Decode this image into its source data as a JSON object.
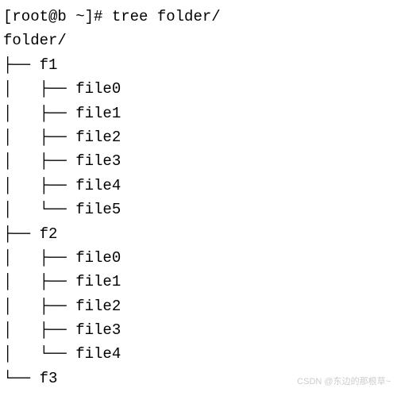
{
  "prompt": {
    "prefix": "[root@b ~]# ",
    "command": "tree folder/"
  },
  "root": "folder/",
  "tree": [
    {
      "prefix": "├── ",
      "indent": "",
      "name": "f1"
    },
    {
      "prefix": "├── ",
      "indent": "│   ",
      "name": "file0"
    },
    {
      "prefix": "├── ",
      "indent": "│   ",
      "name": "file1"
    },
    {
      "prefix": "├── ",
      "indent": "│   ",
      "name": "file2"
    },
    {
      "prefix": "├── ",
      "indent": "│   ",
      "name": "file3"
    },
    {
      "prefix": "├── ",
      "indent": "│   ",
      "name": "file4"
    },
    {
      "prefix": "└── ",
      "indent": "│   ",
      "name": "file5"
    },
    {
      "prefix": "├── ",
      "indent": "",
      "name": "f2"
    },
    {
      "prefix": "├── ",
      "indent": "│   ",
      "name": "file0"
    },
    {
      "prefix": "├── ",
      "indent": "│   ",
      "name": "file1"
    },
    {
      "prefix": "├── ",
      "indent": "│   ",
      "name": "file2"
    },
    {
      "prefix": "├── ",
      "indent": "│   ",
      "name": "file3"
    },
    {
      "prefix": "└── ",
      "indent": "│   ",
      "name": "file4"
    },
    {
      "prefix": "└── ",
      "indent": "",
      "name": "f3"
    }
  ],
  "watermark": "CSDN @东边的那根草~"
}
